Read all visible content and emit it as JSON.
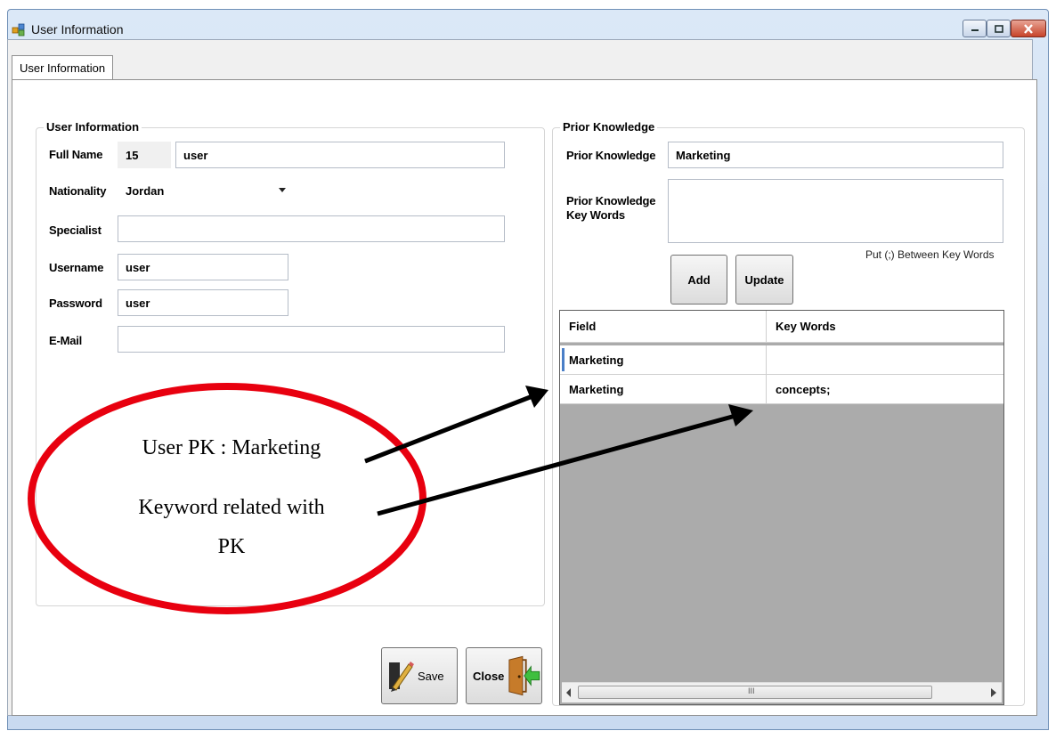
{
  "window": {
    "title": "User Information"
  },
  "tabs": [
    {
      "label": "User Information"
    }
  ],
  "user_info": {
    "group_title": "User Information",
    "full_name_label": "Full Name",
    "user_id": "15",
    "full_name_value": "user",
    "nationality_label": "Nationality",
    "nationality_value": "Jordan",
    "specialist_label": "Specialist",
    "specialist_value": "",
    "username_label": "Username",
    "username_value": "user",
    "password_label": "Password",
    "password_value": "user",
    "email_label": "E-Mail",
    "email_value": ""
  },
  "prior_knowledge": {
    "group_title": "Prior Knowledge",
    "pk_label": "Prior Knowledge",
    "pk_value": "Marketing",
    "kw_label_line1": "Prior Knowledge",
    "kw_label_line2": "Key Words",
    "kw_value": "",
    "hint": "Put (;) Between Key Words",
    "add_label": "Add",
    "update_label": "Update"
  },
  "grid": {
    "columns": [
      "Field",
      "Key Words"
    ],
    "rows": [
      {
        "field": "Marketing",
        "keywords": ""
      },
      {
        "field": "Marketing",
        "keywords": "concepts;"
      }
    ],
    "scroll_grip": "III"
  },
  "buttons": {
    "save_label": "Save",
    "close_label": "Close"
  },
  "annotation": {
    "line1": "User PK : Marketing",
    "line2a": "Keyword related with",
    "line2b": "PK",
    "ellipse_color": "#e8000f"
  }
}
